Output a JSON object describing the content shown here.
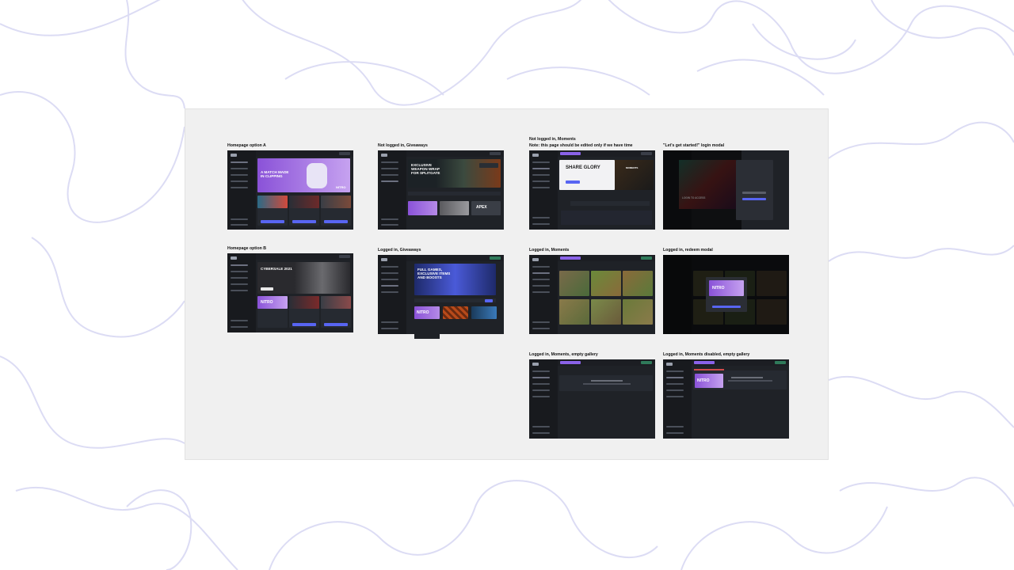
{
  "labels": {
    "homepage_a": "Homepage option A",
    "homepage_b": "Homepage option B",
    "not_logged_giveaways": "Not logged in, Giveaways",
    "logged_giveaways": "Logged in, Giveaways",
    "not_logged_moments_1": "Not logged in, Moments",
    "not_logged_moments_2": "Note: this page should be edited only if we have time",
    "login_modal": "\"Let's get started!\" login modal",
    "logged_moments": "Logged in, Moments",
    "redeem_modal": "Logged in, redeem modal",
    "moments_empty": "Logged in, Moments, empty gallery",
    "moments_disabled_empty": "Logged in, Moments disabled, empty gallery"
  },
  "screens": {
    "homepage_a": {
      "hero_title_1": "A MATCH MADE",
      "hero_title_2": "IN CLIPPING",
      "nitro": "NITRO"
    },
    "homepage_b": {
      "hero_title": "CYBERSALE 2021",
      "nitro": "NITRO"
    },
    "not_logged_giveaways": {
      "hero_title_1": "EXCLUSIVE",
      "hero_title_2": "WEAPON WRAP",
      "hero_title_3": "FOR SPLITGATE",
      "apex": "APEX"
    },
    "logged_giveaways": {
      "hero_title_1": "FULL GAMES,",
      "hero_title_2": "EXCLUSIVE ITEMS",
      "hero_title_3": "AND BOOSTS",
      "nitro": "NITRO"
    },
    "not_logged_moments": {
      "share_title": "SHARE GLORY",
      "moments_word": "MOMENTS"
    },
    "login_modal": {
      "login_heading": "LOGIN TO ACCESS"
    },
    "redeem_modal": {
      "nitro": "NITRO"
    },
    "moments_disabled": {
      "nitro": "NITRO"
    }
  }
}
